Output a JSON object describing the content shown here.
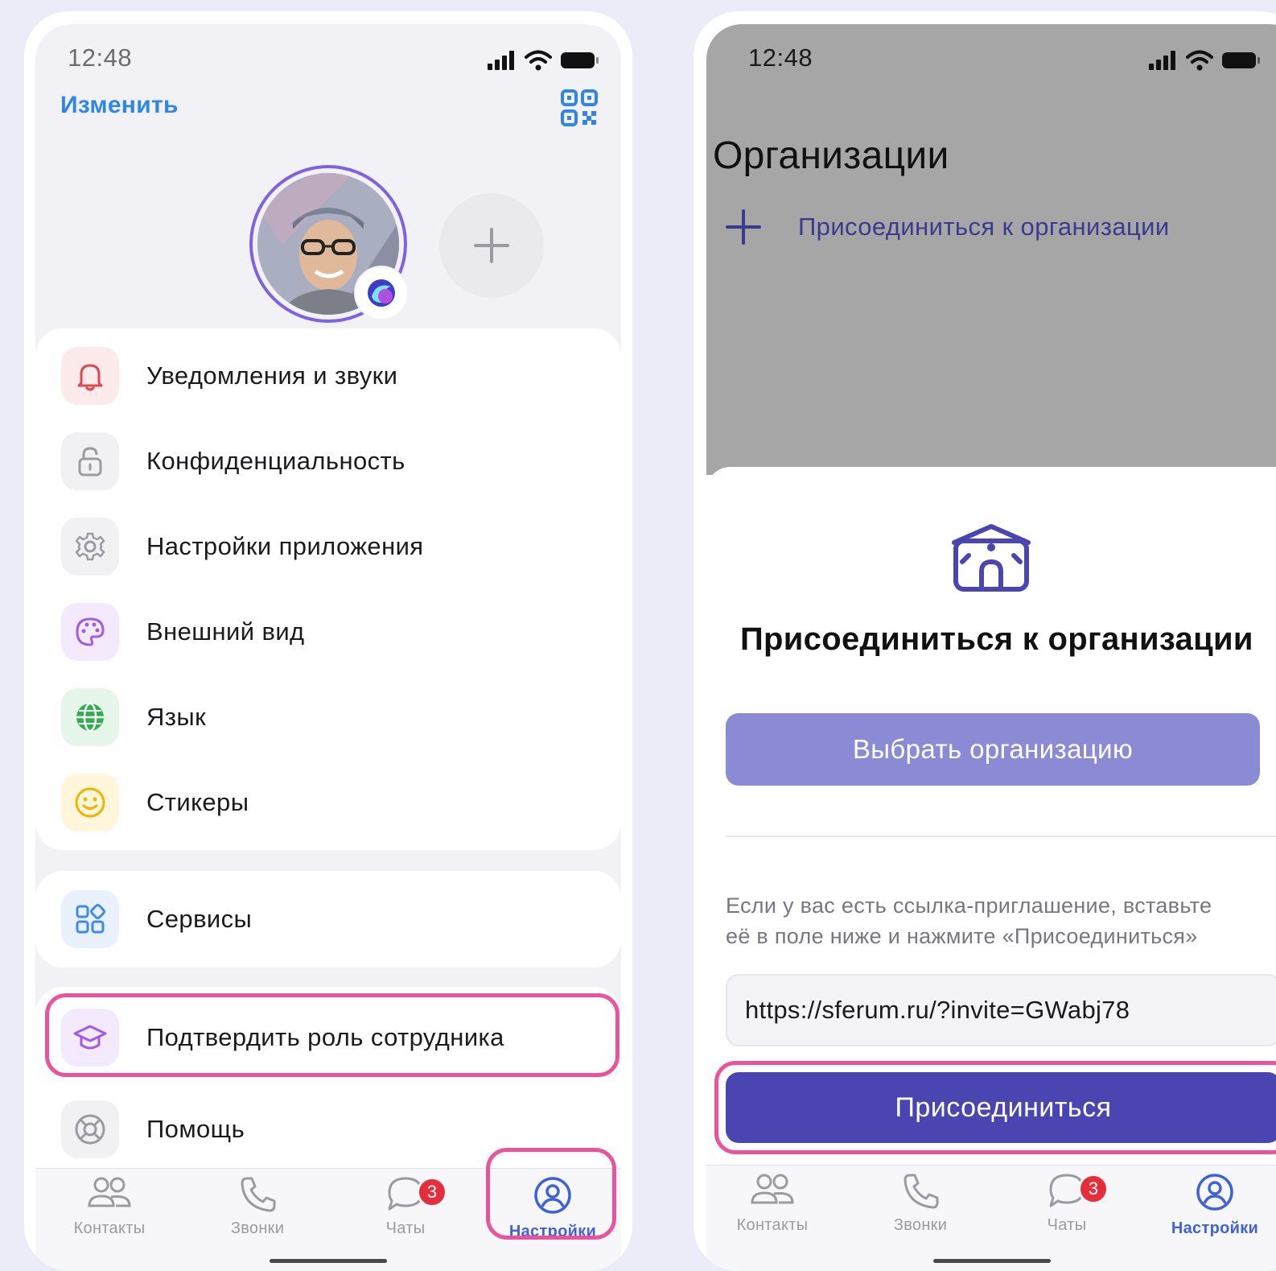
{
  "left_screen": {
    "status_time": "12:48",
    "edit_label": "Изменить",
    "menu_main": [
      {
        "label": "Уведомления и звуки",
        "icon": "bell-icon",
        "color": "#e5434f",
        "bg": "#fdebec"
      },
      {
        "label": "Конфиденциальность",
        "icon": "lock-icon",
        "color": "#9a9aa2",
        "bg": "#f1f1f4"
      },
      {
        "label": "Настройки приложения",
        "icon": "gear-icon",
        "color": "#9a9aa2",
        "bg": "#f1f1f4"
      },
      {
        "label": "Внешний вид",
        "icon": "palette-icon",
        "color": "#a05ce8",
        "bg": "#f3ebfd"
      },
      {
        "label": "Язык",
        "icon": "globe-icon",
        "color": "#2fb04f",
        "bg": "#e7f6ea"
      },
      {
        "label": "Стикеры",
        "icon": "smile-icon",
        "color": "#f0b400",
        "bg": "#fff6dc"
      }
    ],
    "menu_services": {
      "label": "Сервисы",
      "icon": "grid-icon",
      "color": "#3f8ae8",
      "bg": "#e8f1fd"
    },
    "menu_extra": [
      {
        "label": "Подтвердить роль сотрудника",
        "icon": "graduation-cap-icon",
        "color": "#a05ce8",
        "bg": "#f3ebfd"
      },
      {
        "label": "Помощь",
        "icon": "lifebuoy-icon",
        "color": "#9a9aa2",
        "bg": "#f1f1f4"
      }
    ]
  },
  "right_screen": {
    "status_time": "12:48",
    "page_title": "Организации",
    "join_row_label": "Присоединиться к организации",
    "sheet_title": "Присоединиться к организации",
    "choose_button": "Выбрать организацию",
    "hint_line1": "Если у вас есть ссылка-приглашение, вставьте",
    "hint_line2": "её в поле ниже и нажмите «Присоединиться»",
    "invite_value": "https://sferum.ru/?invite=GWabj78",
    "join_button": "Присоединиться"
  },
  "tabs": [
    {
      "label": "Контакты",
      "icon": "contacts-icon"
    },
    {
      "label": "Звонки",
      "icon": "phone-icon"
    },
    {
      "label": "Чаты",
      "icon": "chat-icon",
      "badge": "3"
    },
    {
      "label": "Настройки",
      "icon": "profile-icon",
      "active": true
    }
  ],
  "colors": {
    "accent_blue": "#2f86e8",
    "active_tab": "#3f62d9",
    "highlight_pink": "#e9559d",
    "primary_button": "#4a45b1",
    "secondary_button": "#8b8ad4",
    "badge_red": "#e62d3c"
  }
}
